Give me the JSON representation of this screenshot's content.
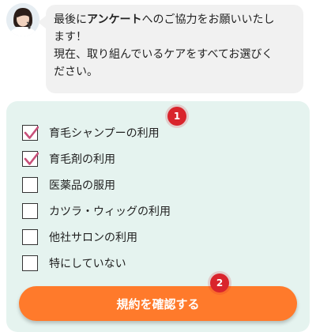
{
  "chat": {
    "line1_pre": "最後に",
    "line1_bold": "アンケート",
    "line1_post": "へのご協力をお願いいたし",
    "line2": "ます！",
    "line3": "現在、取り組んでいるケアをすべてお選びく",
    "line4": "ださい。"
  },
  "survey": {
    "options": [
      {
        "label": "育毛シャンプーの利用",
        "checked": true
      },
      {
        "label": "育毛剤の利用",
        "checked": true
      },
      {
        "label": "医薬品の服用",
        "checked": false
      },
      {
        "label": "カツラ・ウィッグの利用",
        "checked": false
      },
      {
        "label": "他社サロンの利用",
        "checked": false
      },
      {
        "label": "特にしていない",
        "checked": false
      }
    ],
    "submit_label": "規約を確認する"
  },
  "annotations": {
    "badge1": "1",
    "badge2": "2"
  },
  "colors": {
    "card_bg": "#e5f3ef",
    "bubble_bg": "#f1f1f1",
    "cta": "#ff7a2b",
    "checkmark": "#c8507a",
    "badge": "#d9242c"
  }
}
